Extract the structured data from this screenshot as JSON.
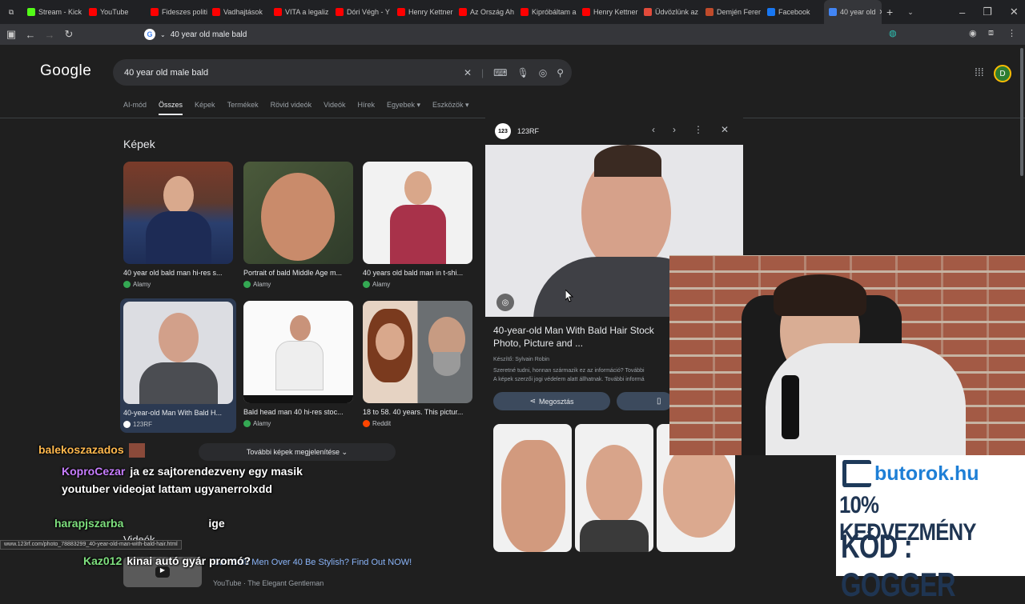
{
  "browser": {
    "tabs": [
      {
        "label": "Stream - Kick",
        "color": "#53fc18"
      },
      {
        "label": "YouTube",
        "color": "#ff0000"
      },
      {
        "label": "Fideszes politi",
        "color": "#ff0000"
      },
      {
        "label": "Vadhajtások",
        "color": "#ff0000"
      },
      {
        "label": "VITA a legaliz",
        "color": "#ff0000"
      },
      {
        "label": "Dóri Végh - Y",
        "color": "#ff0000"
      },
      {
        "label": "Henry Kettner",
        "color": "#ff0000"
      },
      {
        "label": "Az Ország Ah",
        "color": "#ff0000"
      },
      {
        "label": "Kipróbáltam a",
        "color": "#ff0000"
      },
      {
        "label": "Henry Kettner",
        "color": "#ff0000"
      },
      {
        "label": "Üdvözlünk az",
        "color": "#e24b3b"
      },
      {
        "label": "Demjén Ferer",
        "color": "#c04b2b"
      },
      {
        "label": "Facebook",
        "color": "#1877f2"
      },
      {
        "label": "40 year old",
        "color": "#4285f4"
      }
    ],
    "url": "40 year old male bald"
  },
  "google": {
    "logo": "Google",
    "query": "40 year old male bald",
    "tabs": [
      "AI-mód",
      "Összes",
      "Képek",
      "Termékek",
      "Rövid videók",
      "Videók",
      "Hírek",
      "Egyebek ▾",
      "Eszközök ▾"
    ],
    "images_title": "Képek",
    "results": [
      {
        "caption": "40 year old bald man hi-res s...",
        "source": "Alamy"
      },
      {
        "caption": "Portrait of bald Middle Age m...",
        "source": "Alamy"
      },
      {
        "caption": "40 years old bald man in t-shi...",
        "source": "Alamy"
      },
      {
        "caption": "40-year-old Man With Bald H...",
        "source": "123RF"
      },
      {
        "caption": "Bald head man 40 hi-res stoc...",
        "source": "Alamy"
      },
      {
        "caption": "18 to 58. 40 years. This pictur...",
        "source": "Reddit"
      }
    ],
    "more_images": "További képek megjelenítése",
    "videos_title": "Videók",
    "video": {
      "title": "Can Bald Men Over 40 Be Stylish? Find Out NOW!",
      "source": "YouTube · The Elegant Gentleman"
    },
    "status_url": "www.123rf.com/photo_78883299_40-year-old-man-with-bald-hair.html"
  },
  "panel": {
    "site": "123RF",
    "title": "40-year-old Man With Bald Hair Stock Photo, Picture and ...",
    "author": "Készítő: Sylvain Robin",
    "license": "Szeretné tudni, honnan származik ez az információ? További",
    "rights": "A képek szerzői jogi védelem alatt állhatnak. További informá",
    "share": "Megosztás"
  },
  "chat": [
    {
      "user": "balekoszazados",
      "color": "#ffb84d",
      "msg": ""
    },
    {
      "user": "KoproCezar",
      "color": "#c77dff",
      "msg": "ja ez sajtorendezveny egy masik youtuber videojat lattam ugyanerrolxdd"
    },
    {
      "user": "harapjszarba",
      "color": "#7ee07e",
      "msg": "ige"
    },
    {
      "user": "Kaz012",
      "color": "#7ee07e",
      "msg": "kinai autó gyár promó?"
    }
  ],
  "ad": {
    "brand": "butorok.hu",
    "line1": "10% KEDVEZMÉNY",
    "line2": "KÓD : GOGGER"
  }
}
